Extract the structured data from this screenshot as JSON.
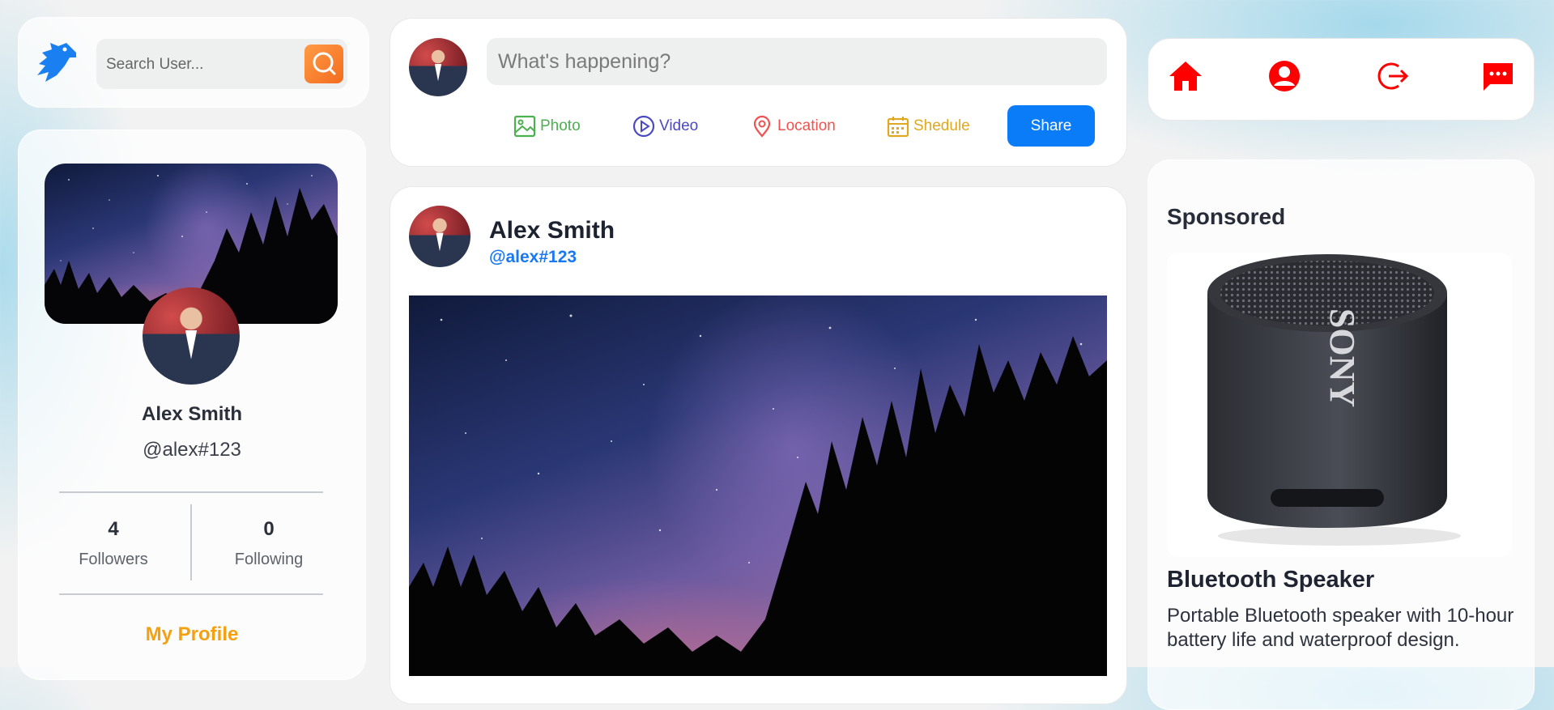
{
  "search": {
    "placeholder": "Search User..."
  },
  "profile": {
    "name": "Alex Smith",
    "handle": "@alex#123",
    "followers_count": "4",
    "followers_label": "Followers",
    "following_count": "0",
    "following_label": "Following",
    "my_profile_label": "My Profile"
  },
  "composer": {
    "placeholder": "What's happening?",
    "actions": {
      "photo": "Photo",
      "video": "Video",
      "location": "Location",
      "schedule": "Shedule"
    },
    "share_label": "Share"
  },
  "post": {
    "author": "Alex Smith",
    "handle": "@alex#123"
  },
  "nav": {
    "icons": [
      "home-icon",
      "profile-icon",
      "logout-icon",
      "messages-icon"
    ]
  },
  "sponsored": {
    "title": "Sponsored",
    "product_brand": "SONY",
    "product_title": "Bluetooth Speaker",
    "product_description": "Portable Bluetooth speaker with 10-hour battery life and waterproof design."
  },
  "colors": {
    "accent_orange": "#f5a010",
    "primary_blue": "#0a7cf7",
    "nav_red": "#ff0000",
    "photo_green": "#4caf50",
    "video_purple": "#4a4ac0",
    "location_red": "#ef5350",
    "schedule_yellow": "#e0a820"
  }
}
